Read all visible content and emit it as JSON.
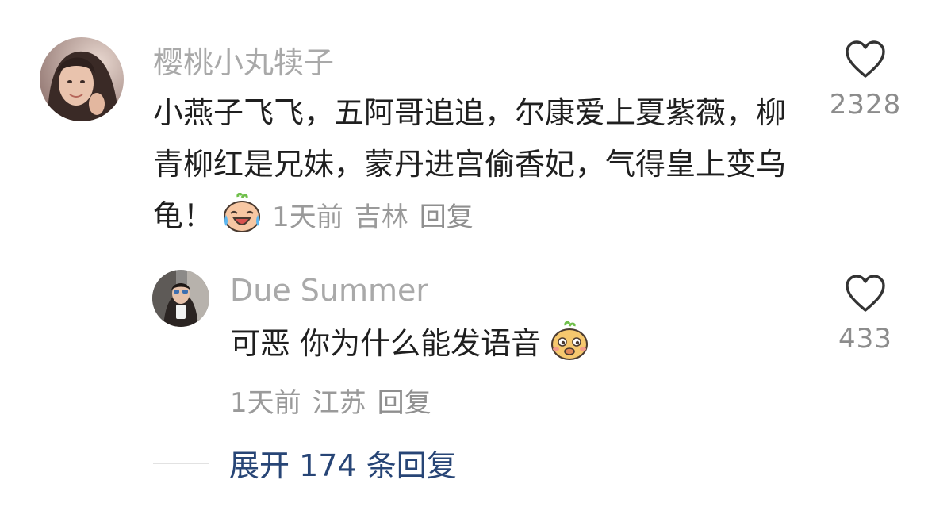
{
  "comment": {
    "username": "樱桃小丸犊子",
    "text": "小燕子飞飞，五阿哥追追，尔康爱上夏紫薇，柳青柳红是兄妹，蒙丹进宫偷香妃，气得皇上变乌龟！",
    "emoji": "crying-laughing-emoji",
    "time": "1天前",
    "location": "吉林",
    "reply_label": "回复",
    "likes": "2328"
  },
  "reply": {
    "username": "Due Summer",
    "text": "可恶 你为什么能发语音",
    "emoji": "smirking-emoji",
    "time": "1天前",
    "location": "江苏",
    "reply_label": "回复",
    "likes": "433"
  },
  "expand": {
    "label": "展开 174 条回复"
  },
  "colors": {
    "username": "#a9a9a9",
    "meta": "#9a9a9a",
    "expand_link": "#274576",
    "body_text": "#1f1f1f"
  }
}
